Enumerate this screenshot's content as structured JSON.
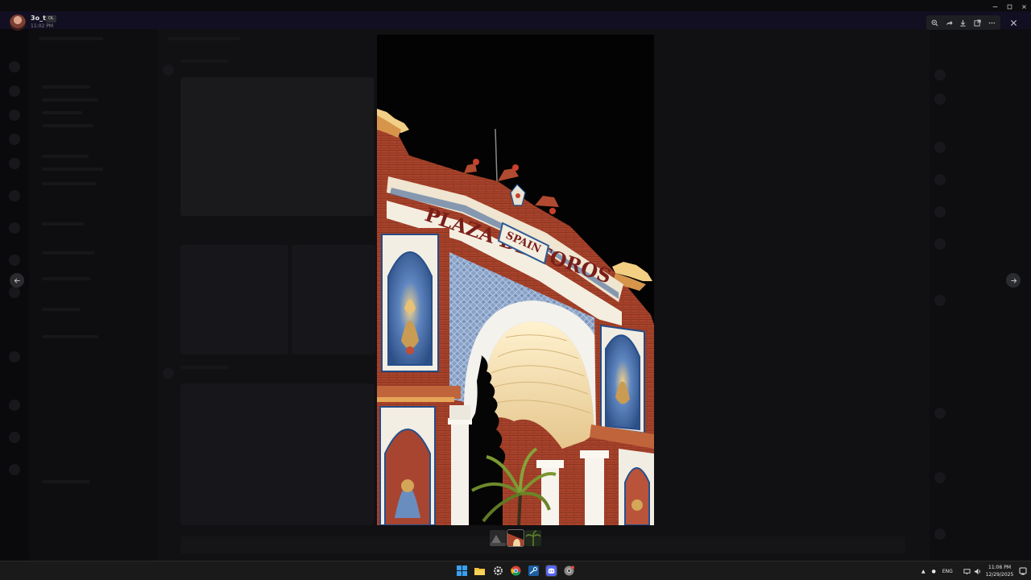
{
  "viewer": {
    "author_name": "3o_t",
    "author_tag": "OL",
    "timestamp": "11:02 PM",
    "toolbar": {
      "zoom_icon": "zoom-icon",
      "forward_icon": "forward-icon",
      "download_icon": "download-icon",
      "open_icon": "open-in-browser-icon",
      "more_icon": "more-icon"
    },
    "close_icon": "close-icon",
    "prev_icon": "arrow-left-icon",
    "next_icon": "arrow-right-icon",
    "thumbnail_count": 3,
    "selected_thumbnail": 2
  },
  "photo": {
    "sign_main": "PLAZA DE TOROS",
    "sign_small": "SPAIN"
  },
  "taskbar": {
    "apps": [
      "start-icon",
      "file-explorer-icon",
      "settings-icon",
      "chrome-icon",
      "steam-icon",
      "discord-icon",
      "chrome-alt-icon"
    ],
    "language": "ENG",
    "time": "11:06 PM",
    "date": "12/29/2025"
  },
  "colors": {
    "overlay_bg": "#000000",
    "toolbar_bg": "#1e1f22",
    "brick": "#a8432c",
    "tile_blue": "#8fa9cf",
    "arch_glow": "#f1d9a6"
  }
}
